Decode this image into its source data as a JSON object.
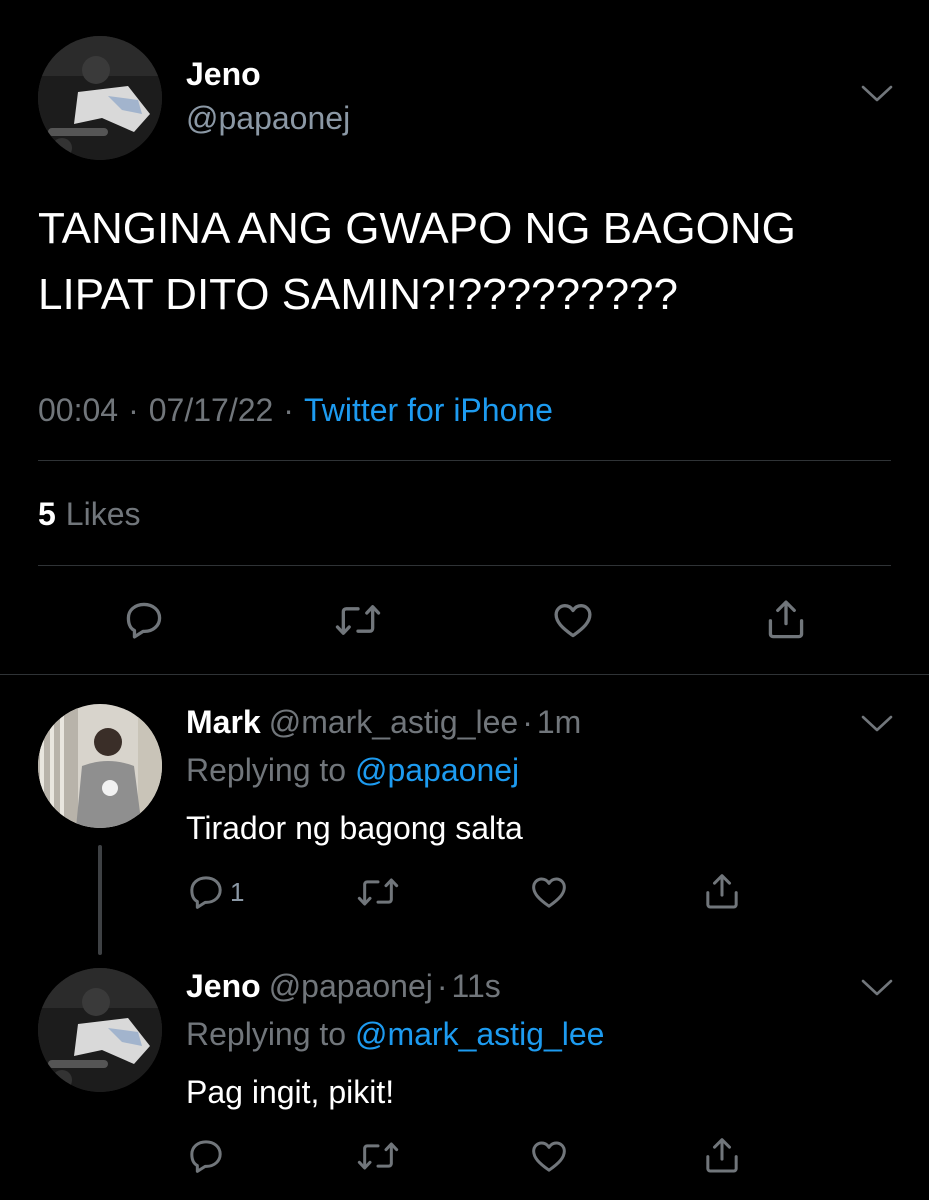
{
  "main_tweet": {
    "author_name": "Jeno",
    "author_handle": "@papaonej",
    "text": "TANGINA ANG GWAPO NG BAGONG LIPAT DITO SAMIN?!?????????",
    "time": "00:04",
    "date": "07/17/22",
    "meta_separator": "·",
    "source": "Twitter for iPhone",
    "likes_count": "5",
    "likes_label": "Likes",
    "icons": [
      "reply-icon",
      "retweet-icon",
      "like-icon",
      "share-icon",
      "chevron-down-icon"
    ]
  },
  "replies": [
    {
      "author_name": "Mark",
      "author_handle": "@mark_astig_lee",
      "separator": "·",
      "time_ago": "1m",
      "replying_prefix": "Replying to",
      "replying_to": "@papaonej",
      "text": "Tirador ng bagong salta",
      "reply_count": "1"
    },
    {
      "author_name": "Jeno",
      "author_handle": "@papaonej",
      "separator": "·",
      "time_ago": "11s",
      "replying_prefix": "Replying to",
      "replying_to": "@mark_astig_lee",
      "text": "Pag ingit, pikit!",
      "reply_count": ""
    }
  ],
  "colors": {
    "background": "#000000",
    "primary_text": "#ffffff",
    "secondary_text": "#71767b",
    "accent": "#1d9bf0",
    "divider": "#2f3336"
  }
}
